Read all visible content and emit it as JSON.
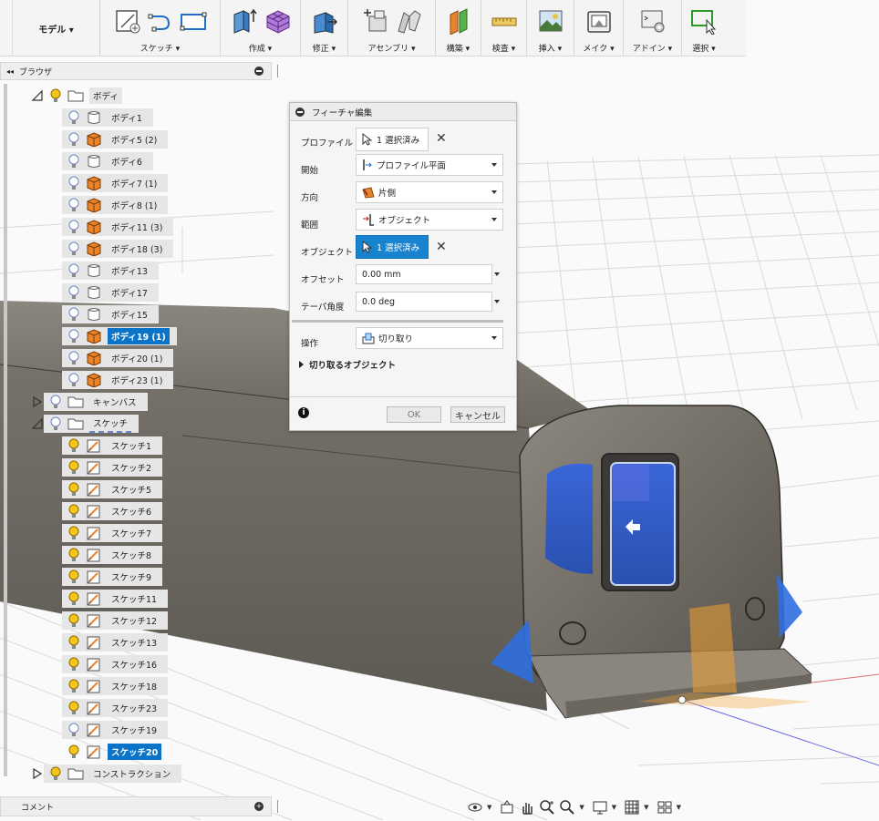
{
  "toolbar": {
    "workspace_label": "モデル ▾",
    "groups": [
      {
        "label": "スケッチ ▾"
      },
      {
        "label": "作成 ▾"
      },
      {
        "label": "修正 ▾"
      },
      {
        "label": "アセンブリ ▾"
      },
      {
        "label": "構築 ▾"
      },
      {
        "label": "検査 ▾"
      },
      {
        "label": "挿入 ▾"
      },
      {
        "label": "メイク ▾"
      },
      {
        "label": "アドイン ▾"
      },
      {
        "label": "選択 ▾"
      }
    ]
  },
  "browser": {
    "title": "ブラウザ",
    "collapse_glyph": "◂◂",
    "bodies_folder": "ボディ",
    "bodies": [
      {
        "label": "ボディ1",
        "type": "surface"
      },
      {
        "label": "ボディ5 (2)",
        "type": "solid"
      },
      {
        "label": "ボディ6",
        "type": "surface"
      },
      {
        "label": "ボディ7 (1)",
        "type": "solid"
      },
      {
        "label": "ボディ8 (1)",
        "type": "solid"
      },
      {
        "label": "ボディ11 (3)",
        "type": "solid"
      },
      {
        "label": "ボディ18 (3)",
        "type": "solid"
      },
      {
        "label": "ボディ13",
        "type": "surface"
      },
      {
        "label": "ボディ17",
        "type": "surface"
      },
      {
        "label": "ボディ15",
        "type": "surface"
      },
      {
        "label": "ボディ19 (1)",
        "type": "solid",
        "selected": true
      },
      {
        "label": "ボディ20 (1)",
        "type": "solid"
      },
      {
        "label": "ボディ23 (1)",
        "type": "solid"
      }
    ],
    "canvas_folder": "キャンバス",
    "sketch_folder": "スケッチ",
    "sketches": [
      {
        "label": "スケッチ1"
      },
      {
        "label": "スケッチ2"
      },
      {
        "label": "スケッチ5"
      },
      {
        "label": "スケッチ6"
      },
      {
        "label": "スケッチ7"
      },
      {
        "label": "スケッチ8"
      },
      {
        "label": "スケッチ9"
      },
      {
        "label": "スケッチ11"
      },
      {
        "label": "スケッチ12"
      },
      {
        "label": "スケッチ13"
      },
      {
        "label": "スケッチ16"
      },
      {
        "label": "スケッチ18"
      },
      {
        "label": "スケッチ23"
      },
      {
        "label": "スケッチ19"
      },
      {
        "label": "スケッチ20",
        "selected": true
      }
    ],
    "construction_folder": "コンストラクション"
  },
  "comments": {
    "title": "コメント"
  },
  "dialog": {
    "title": "フィーチャ編集",
    "profile_label": "プロファイル",
    "profile_value": "1 選択済み",
    "start_label": "開始",
    "start_value": "プロファイル平面",
    "direction_label": "方向",
    "direction_value": "片側",
    "extent_label": "範囲",
    "extent_value": "オブジェクト",
    "object_label": "オブジェクト",
    "object_value": "1 選択済み",
    "offset_label": "オフセット",
    "offset_value": "0.00 mm",
    "taper_label": "テーパ角度",
    "taper_value": "0.0 deg",
    "operation_label": "操作",
    "operation_value": "切り取り",
    "objects_to_cut_label": "切り取るオブジェクト",
    "ok_label": "OK",
    "cancel_label": "キャンセル",
    "clear_glyph": "✕"
  },
  "colors": {
    "accent_blue": "#0b74c8",
    "solid_orange": "#e8852c",
    "model_gray": "#6e6a62"
  }
}
